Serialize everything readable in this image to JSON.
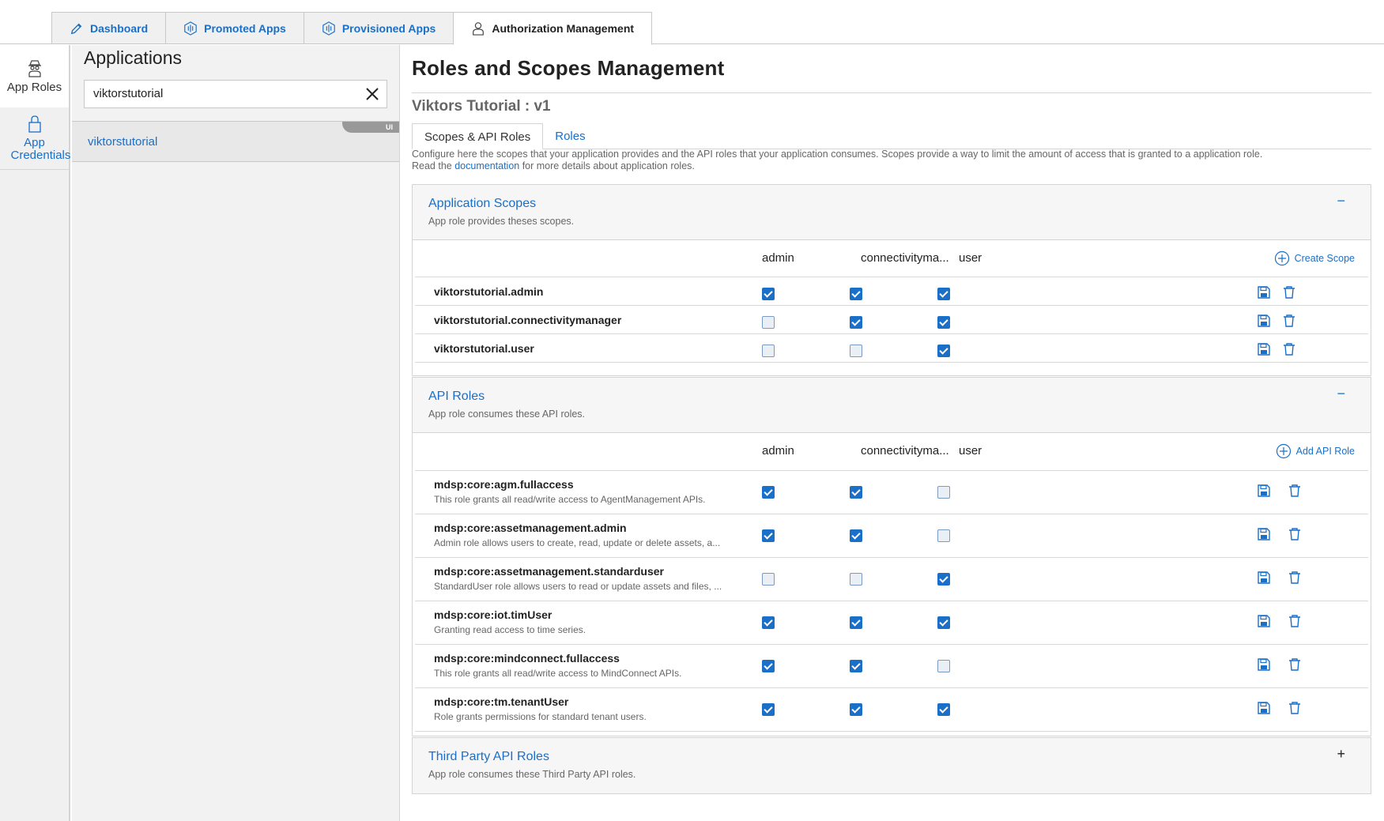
{
  "top_tabs": [
    {
      "label": "Dashboard",
      "icon": "pencil-icon"
    },
    {
      "label": "Promoted Apps",
      "icon": "hexagon-signal-icon"
    },
    {
      "label": "Provisioned Apps",
      "icon": "hexagon-signal-icon"
    },
    {
      "label": "Authorization Management",
      "icon": "user-icon",
      "active": true
    }
  ],
  "left_nav": [
    {
      "label": "App Roles",
      "icon": "spy-user-icon",
      "active": true
    },
    {
      "label": "App Credentials",
      "icon": "lock-icon"
    }
  ],
  "applications": {
    "title": "Applications",
    "search_value": "viktorstutorial",
    "items": [
      {
        "label": "viktorstutorial",
        "badge": "UI"
      }
    ]
  },
  "main": {
    "title": "Roles and Scopes Management",
    "app_subtitle": "Viktors Tutorial : v1",
    "subtabs": [
      "Scopes & API Roles",
      "Roles"
    ],
    "intro_text": "Configure here the scopes that your application provides and the API roles that your application consumes. Scopes provide a way to limit the amount of access that is granted to a application role.",
    "intro_read": "Read the ",
    "intro_link": "documentation",
    "intro_after": " for more details about application roles."
  },
  "columns": [
    "admin",
    "connectivityma...",
    "user"
  ],
  "app_scopes": {
    "title": "Application Scopes",
    "desc": "App role provides theses scopes.",
    "toggle": "−",
    "action_label": "Create Scope",
    "rows": [
      {
        "name": "viktorstutorial.admin",
        "checks": [
          true,
          true,
          true
        ]
      },
      {
        "name": "viktorstutorial.connectivitymanager",
        "checks": [
          false,
          true,
          true
        ]
      },
      {
        "name": "viktorstutorial.user",
        "checks": [
          false,
          false,
          true
        ]
      }
    ]
  },
  "api_roles": {
    "title": "API Roles",
    "desc": "App role consumes these API roles.",
    "toggle": "−",
    "action_label": "Add API Role",
    "rows": [
      {
        "name": "mdsp:core:agm.fullaccess",
        "desc": "This role grants all read/write access to AgentManagement APIs.",
        "checks": [
          true,
          true,
          false
        ]
      },
      {
        "name": "mdsp:core:assetmanagement.admin",
        "desc": "Admin role allows users to create, read, update or delete assets, a...",
        "checks": [
          true,
          true,
          false
        ]
      },
      {
        "name": "mdsp:core:assetmanagement.standarduser",
        "desc": "StandardUser role allows users to read or update assets and files, ...",
        "checks": [
          false,
          false,
          true
        ]
      },
      {
        "name": "mdsp:core:iot.timUser",
        "desc": "Granting read access to time series.",
        "checks": [
          true,
          true,
          true
        ]
      },
      {
        "name": "mdsp:core:mindconnect.fullaccess",
        "desc": "This role grants all read/write access to MindConnect APIs.",
        "checks": [
          true,
          true,
          false
        ]
      },
      {
        "name": "mdsp:core:tm.tenantUser",
        "desc": "Role grants permissions for standard tenant users.",
        "checks": [
          true,
          true,
          true
        ]
      }
    ]
  },
  "third_party": {
    "title": "Third Party API Roles",
    "desc": "App role consumes these Third Party API roles.",
    "toggle": "+"
  },
  "colors": {
    "accent": "#1a6fc9",
    "panel_bg": "#f2f2f2",
    "border": "#d4d4d4"
  }
}
